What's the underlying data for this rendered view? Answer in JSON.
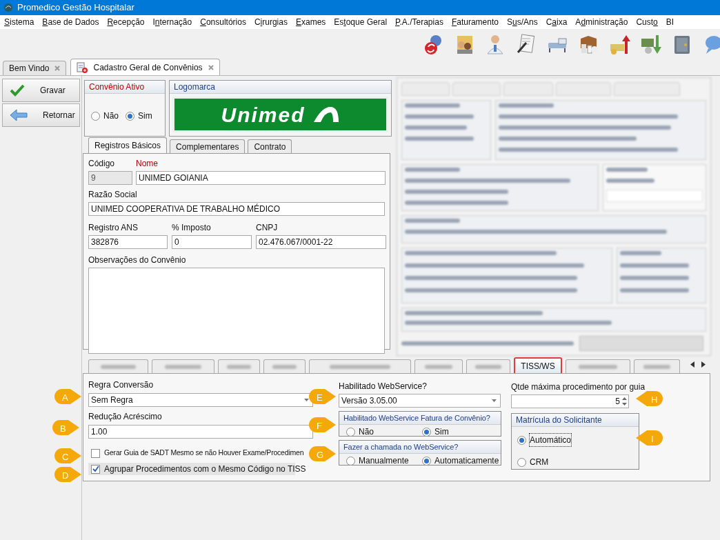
{
  "window": {
    "title": "Promedico Gestão Hospitalar"
  },
  "menu": [
    {
      "key": "S",
      "post": "istema"
    },
    {
      "key": "B",
      "post": "ase de Dados"
    },
    {
      "key": "R",
      "post": "ecepção"
    },
    {
      "pre": "I",
      "key": "n",
      "post": "ternação"
    },
    {
      "key": "C",
      "post": "onsultórios"
    },
    {
      "pre": "C",
      "key": "i",
      "post": "rurgias"
    },
    {
      "key": "E",
      "post": "xames"
    },
    {
      "pre": "Es",
      "key": "t",
      "post": "oque Geral"
    },
    {
      "key": "P",
      "post": ".A./Terapias"
    },
    {
      "key": "F",
      "post": "aturamento"
    },
    {
      "pre": "S",
      "key": "u",
      "post": "s/Ans"
    },
    {
      "pre": "C",
      "key": "a",
      "post": "ixa"
    },
    {
      "pre": "A",
      "key": "d",
      "post": "ministração"
    },
    {
      "pre": "Cust",
      "key": "o"
    },
    {
      "pre": "BI"
    }
  ],
  "doc_tabs": [
    {
      "label": "Bem Vindo",
      "selected": false
    },
    {
      "label": "Cadastro Geral de Convênios",
      "selected": true
    }
  ],
  "sidebar": {
    "buttons": [
      {
        "label": "Gravar",
        "kind": "save"
      },
      {
        "label": "Retornar",
        "kind": "back"
      }
    ]
  },
  "convenio_ativo": {
    "title": "Convênio Ativo",
    "options": [
      {
        "label": "Não",
        "selected": false
      },
      {
        "label": "Sim",
        "selected": true
      }
    ]
  },
  "logomarca": {
    "title": "Logomarca",
    "logo_text": "Unimed"
  },
  "form_tabs": [
    {
      "label": "Registros Básicos",
      "selected": true
    },
    {
      "label": "Complementares",
      "selected": false
    },
    {
      "label": "Contrato",
      "selected": false
    }
  ],
  "registros": {
    "codigo": {
      "label": "Código",
      "value": "9",
      "disabled": true
    },
    "nome": {
      "label": "Nome",
      "value": "UNIMED GOIANIA",
      "required": true
    },
    "razao_social": {
      "label": "Razão Social",
      "value": "UNIMED COOPERATIVA DE TRABALHO MÉDICO"
    },
    "registro_ans": {
      "label": "Registro ANS",
      "value": "382876"
    },
    "imposto": {
      "label": "% Imposto",
      "value": "0"
    },
    "cnpj": {
      "label": "CNPJ",
      "value": "02.476.067/0001-22"
    },
    "observacoes": {
      "label": "Observações do Convênio"
    }
  },
  "bottom_tabs": [
    {
      "selected": false
    },
    {
      "selected": false
    },
    {
      "selected": false
    },
    {
      "selected": false
    },
    {
      "selected": false
    },
    {
      "selected": false
    },
    {
      "selected": false
    },
    {
      "label": "TISS/WS",
      "selected": true,
      "highlighted": true
    },
    {
      "selected": false
    },
    {
      "selected": false
    }
  ],
  "tiss": {
    "regra": {
      "label": "Regra Conversão",
      "value": "Sem Regra"
    },
    "reducao": {
      "label": "Redução Acréscimo",
      "value": "1.00"
    },
    "checks": [
      {
        "label": "Gerar Guia de SADT Mesmo se não Houver Exame/Procedimen",
        "checked": false
      },
      {
        "label": "Agrupar Procedimentos com o Mesmo Código no TISS",
        "checked": true
      }
    ],
    "webservice": {
      "label": "Habilitado WebService?",
      "value": "Versão 3.05.00"
    },
    "fatura": {
      "title": "Habilitado WebService Fatura de Convênio?",
      "options": [
        {
          "label": "Não",
          "selected": false
        },
        {
          "label": "Sim",
          "selected": true
        }
      ]
    },
    "chamada": {
      "title": "Fazer a chamada no WebService?",
      "options": [
        {
          "label": "Manualmente",
          "selected": false
        },
        {
          "label": "Automaticamente",
          "selected": true
        }
      ]
    },
    "qtde": {
      "label": "Qtde máxima procedimento por guia",
      "value": "5"
    },
    "matricula": {
      "title": "Matrícula do Solicitante",
      "options": [
        {
          "label": "Automático",
          "selected": true
        },
        {
          "label": "CRM",
          "selected": false
        }
      ]
    }
  },
  "callouts": [
    {
      "letter": "A"
    },
    {
      "letter": "B"
    },
    {
      "letter": "C"
    },
    {
      "letter": "D"
    },
    {
      "letter": "E"
    },
    {
      "letter": "F"
    },
    {
      "letter": "G"
    },
    {
      "letter": "H"
    },
    {
      "letter": "I"
    }
  ]
}
